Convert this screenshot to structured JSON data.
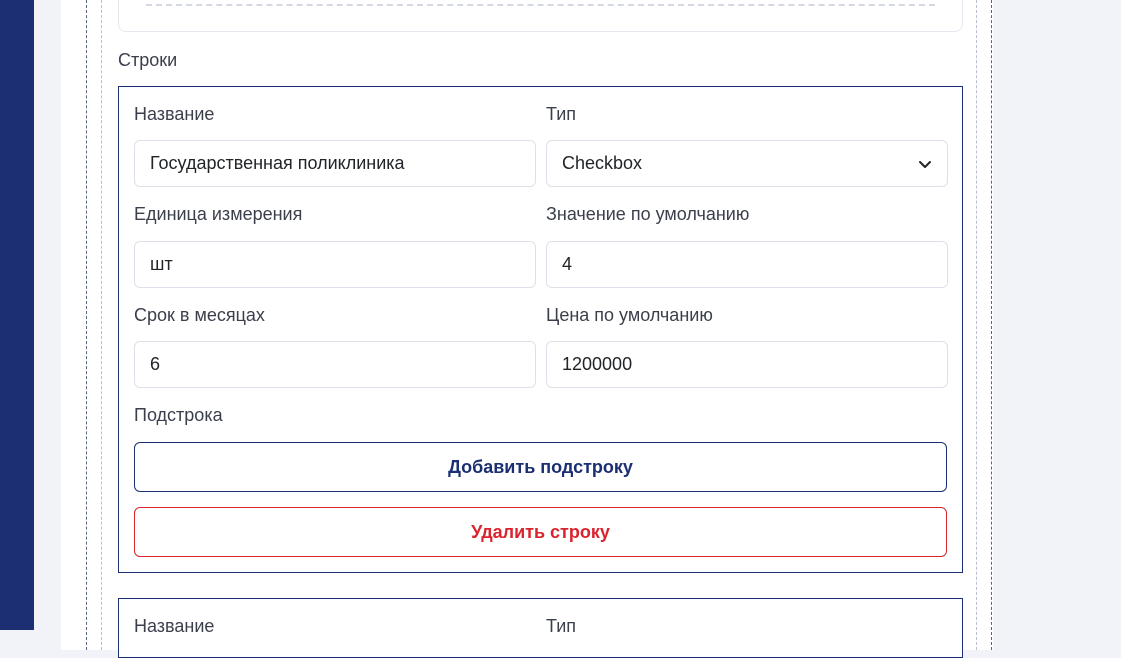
{
  "section": {
    "title": "Строки"
  },
  "row1": {
    "name_label": "Название",
    "name_value": "Государственная поликлиника",
    "type_label": "Тип",
    "type_value": "Checkbox",
    "unit_label": "Единица измерения",
    "unit_value": "шт",
    "default_value_label": "Значение по умолчанию",
    "default_value": "4",
    "term_label": "Срок в месяцах",
    "term_value": "6",
    "price_label": "Цена по умолчанию",
    "price_value": "1200000",
    "subrow_label": "Подстрока",
    "add_subrow_button": "Добавить подстроку",
    "delete_row_button": "Удалить строку"
  },
  "row2": {
    "name_label": "Название",
    "type_label": "Тип"
  },
  "colors": {
    "sidebar": "#1b2f72",
    "primary": "#1b2f72",
    "danger": "#d9232d",
    "background": "#f1f3f8"
  },
  "icons": {
    "select_chevron": "chevron-down-icon"
  }
}
